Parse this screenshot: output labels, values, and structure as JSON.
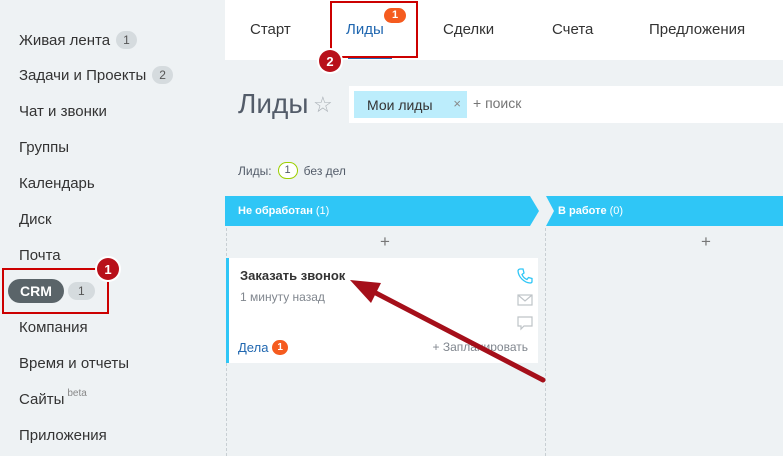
{
  "sidebar": {
    "items": [
      {
        "label": "Живая лента",
        "count": "1"
      },
      {
        "label": "Задачи и Проекты",
        "count": "2"
      },
      {
        "label": "Чат и звонки"
      },
      {
        "label": "Группы"
      },
      {
        "label": "Календарь"
      },
      {
        "label": "Диск"
      },
      {
        "label": "Почта"
      },
      {
        "label": "CRM",
        "count": "1"
      },
      {
        "label": "Компания"
      },
      {
        "label": "Время и отчеты"
      },
      {
        "label": "Сайты",
        "sup": "beta"
      },
      {
        "label": "Приложения"
      }
    ]
  },
  "annotations": {
    "badge1": "1",
    "badge2": "2"
  },
  "tabs": {
    "items": [
      {
        "label": "Старт"
      },
      {
        "label": "Лиды",
        "badge": "1"
      },
      {
        "label": "Сделки"
      },
      {
        "label": "Счета"
      },
      {
        "label": "Предложения"
      }
    ]
  },
  "header": {
    "title": "Лиды",
    "filter_chip": "Мои лиды",
    "chip_close": "×",
    "search_placeholder": "+ поиск"
  },
  "summary": {
    "label": "Лиды:",
    "count": "1",
    "suffix": "без дел"
  },
  "columns": [
    {
      "name": "Не обработан",
      "count": "(1)",
      "add": "+"
    },
    {
      "name": "В работе",
      "count": "(0)",
      "add": "+"
    }
  ],
  "card": {
    "title": "Заказать звонок",
    "time": "1 минуту назад",
    "deals_label": "Дела",
    "deals_count": "1",
    "plan_label": "+ Запланировать"
  },
  "colors": {
    "accent": "#2fc6f6",
    "link": "#2067b0",
    "badge": "#f55b1f",
    "annotation": "#c00"
  }
}
